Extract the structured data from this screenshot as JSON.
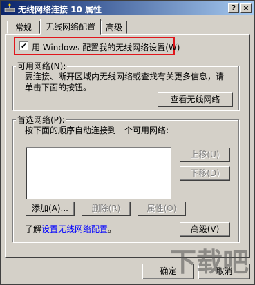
{
  "window": {
    "title": "无线网络连接 10 属性",
    "help_button": "?",
    "close_button": "×"
  },
  "tabs": [
    {
      "label": "常规"
    },
    {
      "label": "无线网络配置"
    },
    {
      "label": "高级"
    }
  ],
  "use_windows_checkbox": {
    "checked": true,
    "mark": "✔",
    "label": "用 Windows 配置我的无线网络设置(W)"
  },
  "available_networks": {
    "group_label": "可用网络(N):",
    "description_line1": "要连接、断开区域内无线网络或查找有关更多信息，请",
    "description_line2": "单击下面的按钮。",
    "view_button": "查看无线网络"
  },
  "preferred_networks": {
    "group_label": "首选网络(P):",
    "description": "按下面的顺序自动连接到一个可用网络:",
    "move_up_button": "上移(U)",
    "move_down_button": "下移(D)",
    "add_button": "添加(A)...",
    "remove_button": "删除(R)",
    "properties_button": "属性(O)"
  },
  "learn_more": {
    "prefix": "了解",
    "link": "设置无线网络配置",
    "suffix": "。"
  },
  "advanced_button": "高级(V)",
  "ok_button": "确定",
  "cancel_button": "取消",
  "watermark": "下载吧"
}
